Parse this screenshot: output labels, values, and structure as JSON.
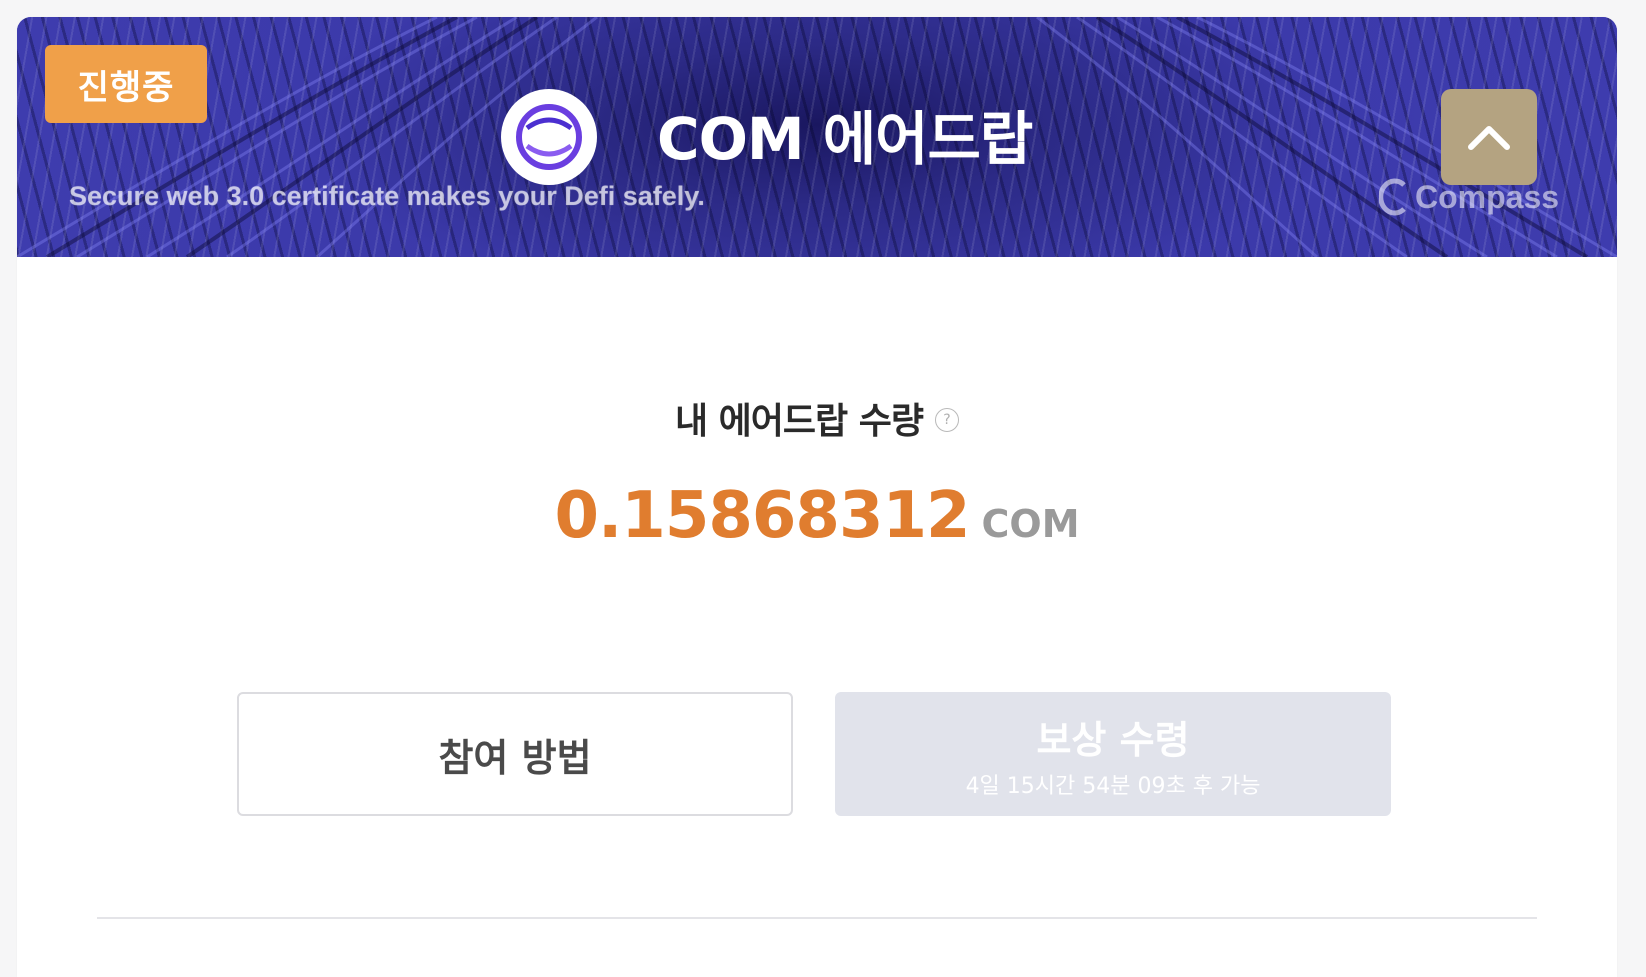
{
  "banner": {
    "status_badge": "진행중",
    "title": "COM 에어드랍",
    "tagline": "Secure web 3.0 certificate makes your Defi safely.",
    "brand_name": "Compass",
    "logo_icon": "token-logo-icon",
    "collapse_icon": "chevron-up-icon"
  },
  "airdrop": {
    "label": "내 에어드랍 수량",
    "help_icon": "question-circle-icon",
    "amount": "0.15868312",
    "unit": "COM"
  },
  "actions": {
    "how_to_label": "참여 방법",
    "claim_label": "보상 수령",
    "claim_countdown": "4일 15시간 54분 09초 후 가능"
  },
  "colors": {
    "badge": "#f0a049",
    "amount": "#e07d2f",
    "collapse_button": "#b4a381",
    "claim_disabled": "#e1e3eb"
  }
}
